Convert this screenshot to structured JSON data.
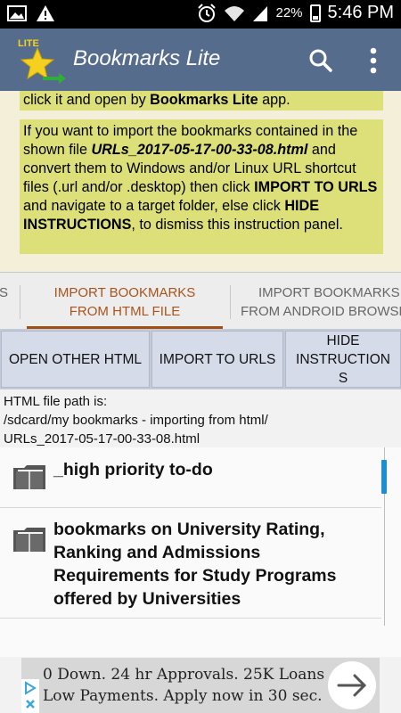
{
  "status_bar": {
    "battery": "22%",
    "time": "5:46 PM",
    "icons": [
      "image-icon",
      "warning-icon",
      "alarm-icon",
      "wifi-icon",
      "signal-icon",
      "battery-icon"
    ]
  },
  "app_bar": {
    "logo_badge": "LITE",
    "title": "Bookmarks Lite",
    "accent": "#566c8c"
  },
  "instructions": {
    "top_line_prefix": "click it and open by ",
    "top_line_bold": "Bookmarks Lite",
    "top_line_suffix": " app.",
    "p1": "If you want to import the bookmarks contained in the shown file ",
    "file_name": "URLs_2017-05-17-00-33-08.html",
    "p2": " and convert them to Windows and/or Linux URL shortcut files (.url and/or .desktop) then click ",
    "import_bold": "IMPORT TO URLS",
    "p3": " and navigate to a target folder, else click ",
    "hide_bold": "HIDE INSTRUCTIONS",
    "p4": ", to dismiss this instruction panel."
  },
  "tabs": {
    "left_partial": "S",
    "active_line1": "IMPORT BOOKMARKS",
    "active_line2": "FROM HTML FILE",
    "right_line1": "IMPORT BOOKMARKS",
    "right_line2": "FROM ANDROID BROWSER"
  },
  "actions": {
    "open_other": "OPEN OTHER HTML",
    "import_urls": "IMPORT TO URLS",
    "hide_line1": "HIDE",
    "hide_line2": "INSTRUCTION",
    "hide_line3": "S"
  },
  "file_path": {
    "label": "HTML file path is:",
    "line1": "/sdcard/my bookmarks - importing from html/",
    "line2": "URLs_2017-05-17-00-33-08.html"
  },
  "list": {
    "items": [
      {
        "label": "_high priority to-do"
      },
      {
        "label": "bookmarks on University Rating, Ranking and Admissions Requirements for Study Programs offered by Universities"
      }
    ]
  },
  "ad": {
    "line1": "0 Down. 24 hr Approvals. 25K Loans",
    "line2": "Low Payments. Apply now in 30 sec."
  }
}
